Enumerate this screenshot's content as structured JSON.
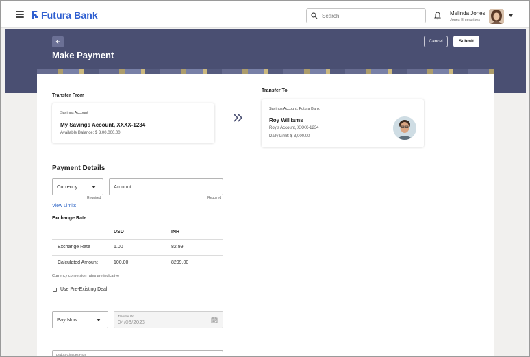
{
  "header": {
    "brand": "Futura Bank",
    "search_placeholder": "Search",
    "user_name": "Melinda Jones",
    "user_org": "Jones Enterprises"
  },
  "banner": {
    "title": "Make Payment",
    "cancel_label": "Cancel",
    "submit_label": "Submit"
  },
  "transfer_from": {
    "heading": "Transfer From",
    "account_type": "Savings Account",
    "account_name": "My Savings Account, XXXX-1234",
    "balance": "Available Balance: $ 3,00,000.00"
  },
  "transfer_to": {
    "heading": "Transfer To",
    "account_type": "Savings Account, Futura Bank",
    "payee_name": "Roy Williams",
    "payee_account": "Roy's Account, XXXX-1234",
    "daily_limit": "Daily Limit: $ 3,000.00"
  },
  "payment_details": {
    "heading": "Payment Details",
    "currency_placeholder": "Currency",
    "currency_required": "Required",
    "amount_placeholder": "Amount",
    "amount_required": "Required",
    "view_limits": "View Limits",
    "exchange_rate_label": "Exchange Rate :",
    "rate_table": {
      "headers": [
        "",
        "USD",
        "INR"
      ],
      "rows": [
        [
          "Exchange Rate",
          "1.00",
          "82.99"
        ],
        [
          "Calculated Amount",
          "100.00",
          "8299.00"
        ]
      ]
    },
    "rate_note": "Currency conversion rates are indicative",
    "pre_existing_deal_label": "Use Pre-Existing Deal",
    "pre_existing_deal_checked": false,
    "pay_when": "Pay Now",
    "transfer_on_label": "Transfer On",
    "transfer_on_value": "04/06/2023",
    "deduct_charges_label": "Deduct Charges From"
  },
  "colors": {
    "brand_blue": "#2f5fd0",
    "banner": "#4a4f72",
    "link": "#2f66c6"
  }
}
